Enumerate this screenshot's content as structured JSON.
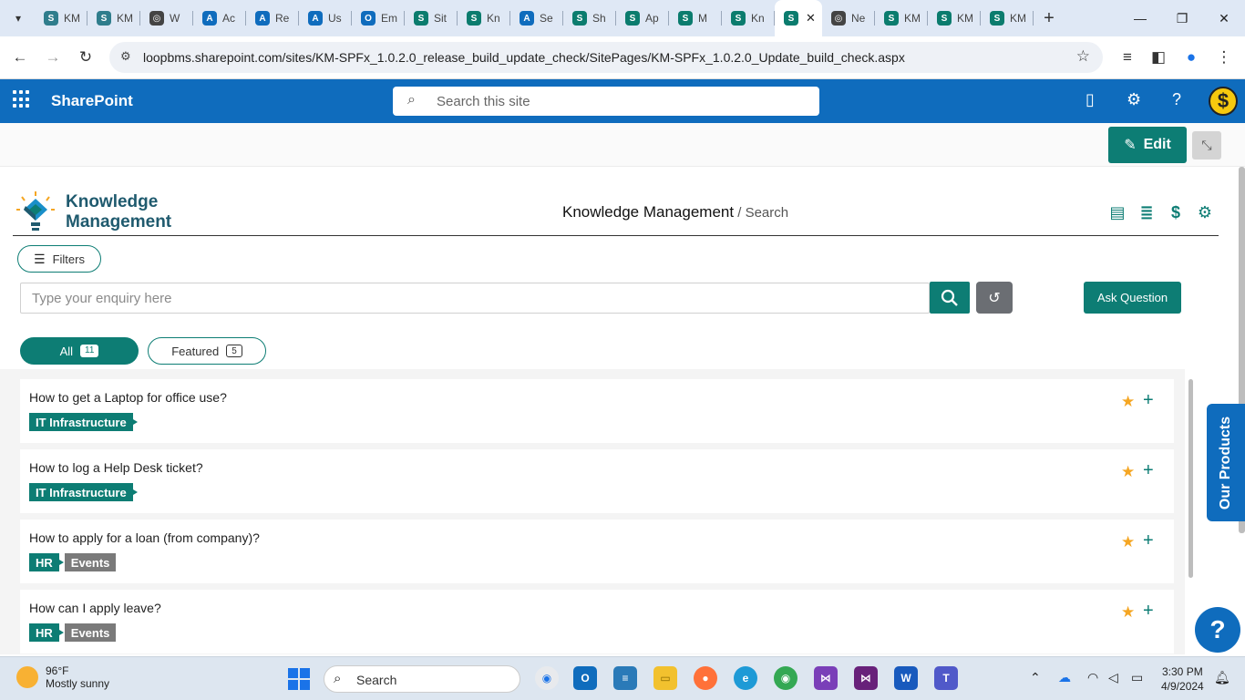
{
  "browser": {
    "tabs": [
      {
        "title": "KM",
        "icon": "sharepoint-icon",
        "color": "#2f7d8c"
      },
      {
        "title": "KM",
        "icon": "sharepoint-icon",
        "color": "#2f7d8c"
      },
      {
        "title": "W",
        "icon": "globe-icon",
        "color": "#444444"
      },
      {
        "title": "Ac",
        "icon": "azure-icon",
        "color": "#0f6cbd"
      },
      {
        "title": "Re",
        "icon": "azure-icon",
        "color": "#0f6cbd"
      },
      {
        "title": "Us",
        "icon": "azure-logo-icon",
        "color": "#0f6cbd"
      },
      {
        "title": "Em",
        "icon": "outlook-icon",
        "color": "#0f6cbd"
      },
      {
        "title": "Sit",
        "icon": "sharepoint-icon",
        "color": "#0b7c6e"
      },
      {
        "title": "Kn",
        "icon": "sharepoint-icon",
        "color": "#0b7c6e"
      },
      {
        "title": "Se",
        "icon": "azure-icon",
        "color": "#0f6cbd"
      },
      {
        "title": "Sh",
        "icon": "sharepoint-icon",
        "color": "#0b7c6e"
      },
      {
        "title": "Ap",
        "icon": "sharepoint-icon",
        "color": "#0b7c6e"
      },
      {
        "title": "M",
        "icon": "sharepoint-icon",
        "color": "#0b7c6e"
      },
      {
        "title": "Kn",
        "icon": "sharepoint-icon",
        "color": "#0b7c6e"
      },
      {
        "title": "",
        "icon": "sharepoint-icon",
        "color": "#0b7c6e",
        "active": true
      },
      {
        "title": "Ne",
        "icon": "globe-icon",
        "color": "#444444"
      },
      {
        "title": "KM",
        "icon": "sharepoint-icon",
        "color": "#0b7c6e"
      },
      {
        "title": "KM",
        "icon": "sharepoint-icon",
        "color": "#0b7c6e"
      },
      {
        "title": "KM",
        "icon": "sharepoint-icon",
        "color": "#0b7c6e"
      }
    ],
    "url": "loopbms.sharepoint.com/sites/KM-SPFx_1.0.2.0_release_build_update_check/SitePages/KM-SPFx_1.0.2.0_Update_build_check.aspx"
  },
  "suitebar": {
    "brand": "SharePoint",
    "search_placeholder": "Search this site"
  },
  "commandbar": {
    "edit_label": "Edit"
  },
  "km": {
    "brand_line1": "Knowledge",
    "brand_line2": "Management",
    "title": "Knowledge Management",
    "crumb": " / Search",
    "filters_label": "Filters",
    "enquiry_placeholder": "Type your enquiry here",
    "ask_label": "Ask Question",
    "pills": {
      "all_label": "All",
      "all_count": "11",
      "featured_label": "Featured",
      "featured_count": "5"
    },
    "questions": [
      {
        "text": "How to get a Laptop for office use?",
        "tags": [
          "IT Infrastructure"
        ]
      },
      {
        "text": "How to log a Help Desk ticket?",
        "tags": [
          "IT Infrastructure"
        ]
      },
      {
        "text": "How to apply for a loan (from company)?",
        "tags": [
          "HR",
          "Events"
        ]
      },
      {
        "text": "How can I apply leave?",
        "tags": [
          "HR",
          "Events"
        ]
      }
    ]
  },
  "our_products": "Our Products",
  "help": "?",
  "taskbar": {
    "temp": "96°F",
    "weather": "Mostly sunny",
    "search": "Search",
    "time": "3:30 PM",
    "date": "4/9/2024"
  },
  "colors": {
    "accent": "#0d7d74",
    "sharepoint_blue": "#0f6cbd",
    "star": "#f5a623"
  }
}
